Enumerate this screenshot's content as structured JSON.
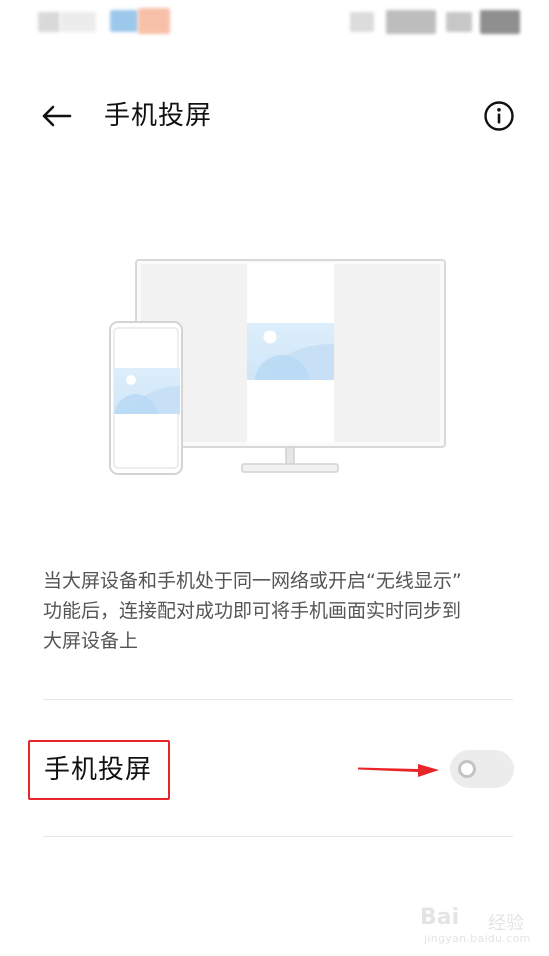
{
  "header": {
    "title": "手机投屏"
  },
  "icons": {
    "back": "arrow-left-icon",
    "info": "info-icon",
    "illustration": "screen-cast-illustration"
  },
  "description": {
    "line1": "当大屏设备和手机处于同一网络或开启“无线显示”",
    "line2": "功能后，连接配对成功即可将手机画面实时同步到",
    "line3": "大屏设备上"
  },
  "setting": {
    "label": "手机投屏",
    "toggle_state": "off"
  },
  "watermark": {
    "brand": "Bai",
    "sub": "经验",
    "url": "jingyan.baidu.com"
  },
  "colors": {
    "annotation_red": "#e8262a",
    "toggle_track": "#ececec",
    "text_secondary": "#555555"
  }
}
